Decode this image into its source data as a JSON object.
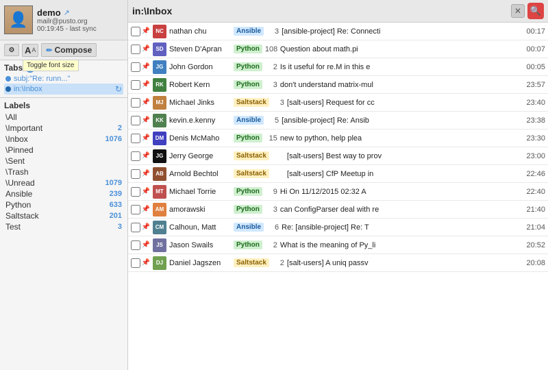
{
  "sidebar": {
    "profile": {
      "name": "demo",
      "email": "mailr@pusto.org",
      "sync": "00:19:45 - last sync",
      "arrow_icon": "→"
    },
    "toolbar": {
      "compose_label": "Compose",
      "font_tooltip": "Toggle font size"
    },
    "tabs": {
      "header": "Tabs",
      "items": [
        {
          "label": "subj:\"Re: runn...\"",
          "active": false
        },
        {
          "label": "in:\\Inbox",
          "active": true
        }
      ]
    },
    "labels": {
      "header": "Labels",
      "items": [
        {
          "name": "\\All",
          "count": ""
        },
        {
          "name": "\\Important",
          "count": "2"
        },
        {
          "name": "\\Inbox",
          "count": "1076"
        },
        {
          "name": "\\Pinned",
          "count": ""
        },
        {
          "name": "\\Sent",
          "count": ""
        },
        {
          "name": "\\Trash",
          "count": ""
        },
        {
          "name": "\\Unread",
          "count": "1079"
        },
        {
          "name": "Ansible",
          "count": "239"
        },
        {
          "name": "Python",
          "count": "633"
        },
        {
          "name": "Saltstack",
          "count": "201"
        },
        {
          "name": "Test",
          "count": "3"
        }
      ]
    }
  },
  "main": {
    "search_label": "in:\\Inbox",
    "emails": [
      {
        "sender": "nathan chu",
        "tag": "Ansible",
        "tag_class": "tag-ansible",
        "count": "3",
        "subject": "[ansible-project] Re: Connecti",
        "time": "00:17",
        "avatar_color": "#c84040",
        "avatar_text": "NC"
      },
      {
        "sender": "Steven D'Apran",
        "tag": "Python",
        "tag_class": "tag-python",
        "count": "108",
        "subject": "Question about math.pi",
        "time": "00:07",
        "avatar_color": "#6060c0",
        "avatar_text": "SD"
      },
      {
        "sender": "John Gordon",
        "tag": "Python",
        "tag_class": "tag-python",
        "count": "2",
        "subject": "Is it useful for re.M in this e",
        "time": "00:05",
        "avatar_color": "#4080c0",
        "avatar_text": "JG"
      },
      {
        "sender": "Robert Kern",
        "tag": "Python",
        "tag_class": "tag-python",
        "count": "3",
        "subject": "don't understand matrix-mul",
        "time": "23:57",
        "avatar_color": "#408040",
        "avatar_text": "RK"
      },
      {
        "sender": "Michael Jinks",
        "tag": "Saltstack",
        "tag_class": "tag-saltstack",
        "count": "3",
        "subject": "[salt-users] Request for cc",
        "time": "23:40",
        "avatar_color": "#c08040",
        "avatar_text": "MJ"
      },
      {
        "sender": "kevin.e.kenny",
        "tag": "Ansible",
        "tag_class": "tag-ansible",
        "count": "5",
        "subject": "[ansible-project] Re: Ansib",
        "time": "23:38",
        "avatar_color": "#508050",
        "avatar_text": "KK"
      },
      {
        "sender": "Denis McMaho",
        "tag": "Python",
        "tag_class": "tag-python",
        "count": "15",
        "subject": "new to python, help plea",
        "time": "23:30",
        "avatar_color": "#4040c0",
        "avatar_text": "DM"
      },
      {
        "sender": "Jerry George",
        "tag": "Saltstack",
        "tag_class": "tag-saltstack",
        "count": "",
        "subject": "[salt-users] Best way to prov",
        "time": "23:00",
        "avatar_color": "#111111",
        "avatar_text": "JG"
      },
      {
        "sender": "Arnold Bechtol",
        "tag": "Saltstack",
        "tag_class": "tag-saltstack",
        "count": "",
        "subject": "[salt-users] CfP Meetup in",
        "time": "22:46",
        "avatar_color": "#905030",
        "avatar_text": "AB"
      },
      {
        "sender": "Michael Torrie",
        "tag": "Python",
        "tag_class": "tag-python",
        "count": "9",
        "subject": "Hi On 11/12/2015 02:32 A",
        "time": "22:40",
        "avatar_color": "#c05050",
        "avatar_text": "MT"
      },
      {
        "sender": "amorawski",
        "tag": "Python",
        "tag_class": "tag-python",
        "count": "3",
        "subject": "can ConfigParser deal with re",
        "time": "21:40",
        "avatar_color": "#e08040",
        "avatar_text": "AM"
      },
      {
        "sender": "Calhoun, Matt",
        "tag": "Ansible",
        "tag_class": "tag-ansible",
        "count": "6",
        "subject": "Re: [ansible-project] Re: T",
        "time": "21:04",
        "avatar_color": "#508090",
        "avatar_text": "CM"
      },
      {
        "sender": "Jason Swails",
        "tag": "Python",
        "tag_class": "tag-python",
        "count": "2",
        "subject": "What is the meaning of Py_li",
        "time": "20:52",
        "avatar_color": "#7070a0",
        "avatar_text": "JS"
      },
      {
        "sender": "Daniel Jagszen",
        "tag": "Saltstack",
        "tag_class": "tag-saltstack",
        "count": "2",
        "subject": "[salt-users] A uniq passv",
        "time": "20:08",
        "avatar_color": "#70a050",
        "avatar_text": "DJ"
      }
    ]
  }
}
